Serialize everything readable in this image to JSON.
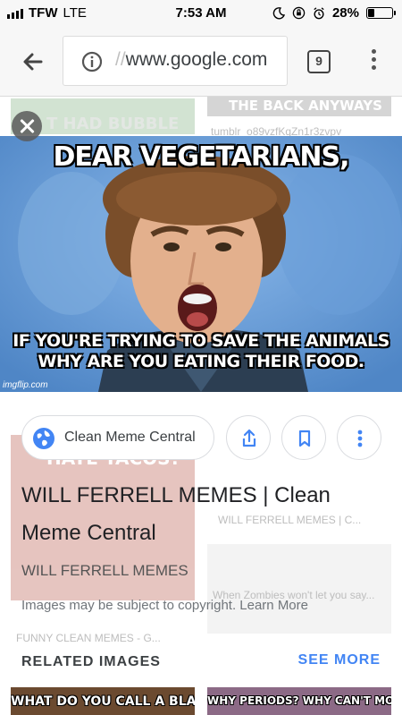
{
  "status_bar": {
    "carrier": "TFW",
    "network": "LTE",
    "time": "7:53 AM",
    "battery": "28%",
    "battery_level": 0.28
  },
  "toolbar": {
    "url_prefix": "//",
    "url": "www.google.com",
    "tab_count": "9"
  },
  "background": {
    "caption_1": "THE BACK ANYWAYS",
    "caption_2": "tumblr_o89vzfKqZn1r3zvpv",
    "caption_3": "T HAD BUBBLE",
    "caption_4": "HATE TACOS?",
    "caption_5": "WILL FERRELL MEMES | C...",
    "caption_6": "When Zombies won't let you say...",
    "caption_7": "FUNNY CLEAN MEMES - G..."
  },
  "meme": {
    "top_text": "DEAR VEGETARIANS,",
    "bottom_line_1": "IF YOU'RE TRYING TO SAVE THE ANIMALS",
    "bottom_line_2": "WHY ARE YOU EATING THEIR FOOD.",
    "watermark": "imgflip.com",
    "sky_color": "#6fa3dc"
  },
  "result": {
    "source": "Clean Meme Central",
    "title": "WILL FERRELL MEMES | Clean Meme Central",
    "site_name": "WILL FERRELL MEMES",
    "copyright": "Images may be subject to copyright. Learn More"
  },
  "related": {
    "label": "RELATED IMAGES",
    "see_more": "SEE MORE",
    "thumb_1": "WHAT DO YOU CALL A BLACK",
    "thumb_2": "WHY PERIODS? WHY CAN'T MOTHER"
  },
  "colors": {
    "accent": "#4285f4",
    "toolbar_bg": "#f7f7f7"
  }
}
